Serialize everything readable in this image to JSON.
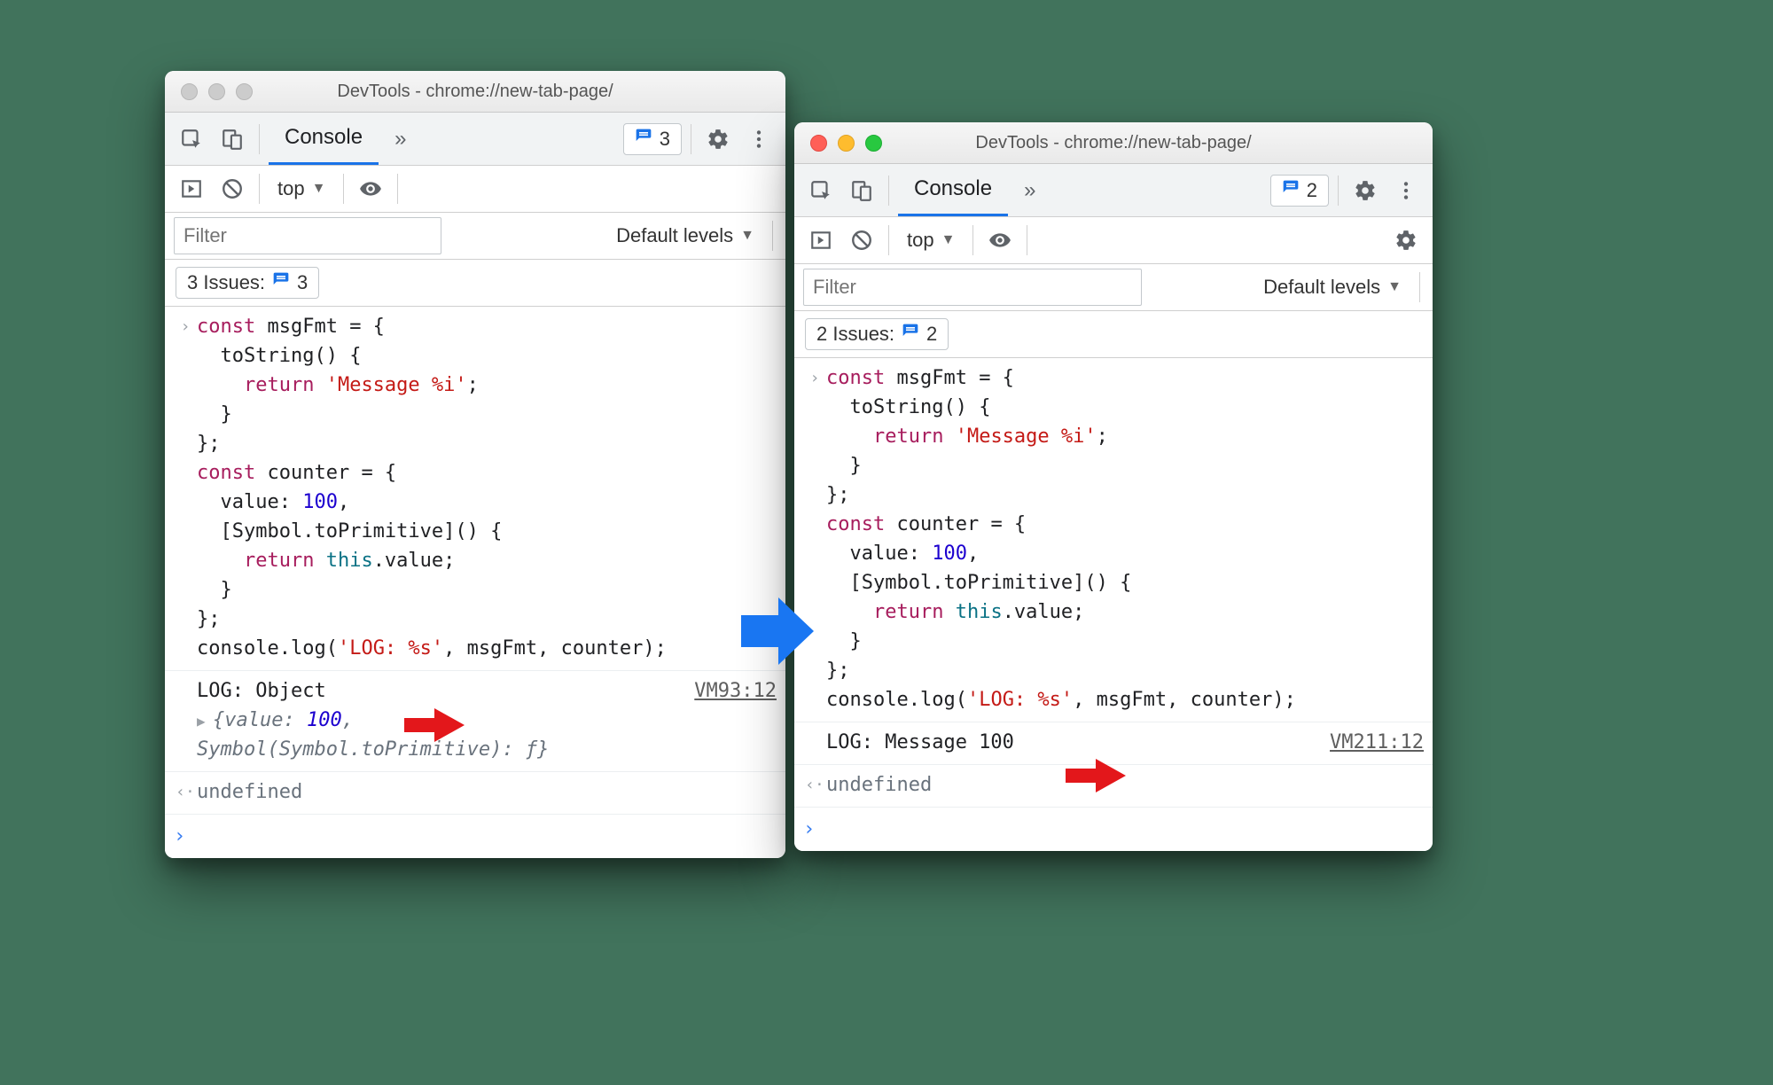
{
  "shared": {
    "title": "DevTools - chrome://new-tab-page/",
    "tab": "Console",
    "context": "top",
    "filter_ph": "Filter",
    "levels": "Default levels",
    "issues_label": "Issues:",
    "undefined": "undefined",
    "chevron": "»",
    "triangle": "▼",
    "code": {
      "l1a": "const",
      "l1b": " msgFmt = {",
      "l2": "  toString() {",
      "l3a": "    return ",
      "l3b": "'Message %i'",
      "l3c": ";",
      "l4": "  }",
      "l5": "};",
      "l6a": "const",
      "l6b": " counter = {",
      "l7a": "  value: ",
      "l7b": "100",
      "l7c": ",",
      "l8": "  [Symbol.toPrimitive]() {",
      "l9a": "    return ",
      "l9b": "this",
      "l9c": ".value;",
      "l10": "  }",
      "l11": "};",
      "l12a": "console.log(",
      "l12b": "'LOG: %s'",
      "l12c": ", msgFmt, counter);"
    }
  },
  "left": {
    "issues_count": "3",
    "issues_pill": "3 Issues: ",
    "issues_pill_n": "3",
    "out_text": "LOG: Object",
    "out_link": "VM93:12",
    "expand_a": "{value: ",
    "expand_num": "100",
    "expand_b": ", Symbol(Symbol.toPrimitive): ƒ}"
  },
  "right": {
    "issues_count": "2",
    "issues_pill": "2 Issues: ",
    "issues_pill_n": "2",
    "out_text": "LOG: Message 100",
    "out_link": "VM211:12"
  }
}
